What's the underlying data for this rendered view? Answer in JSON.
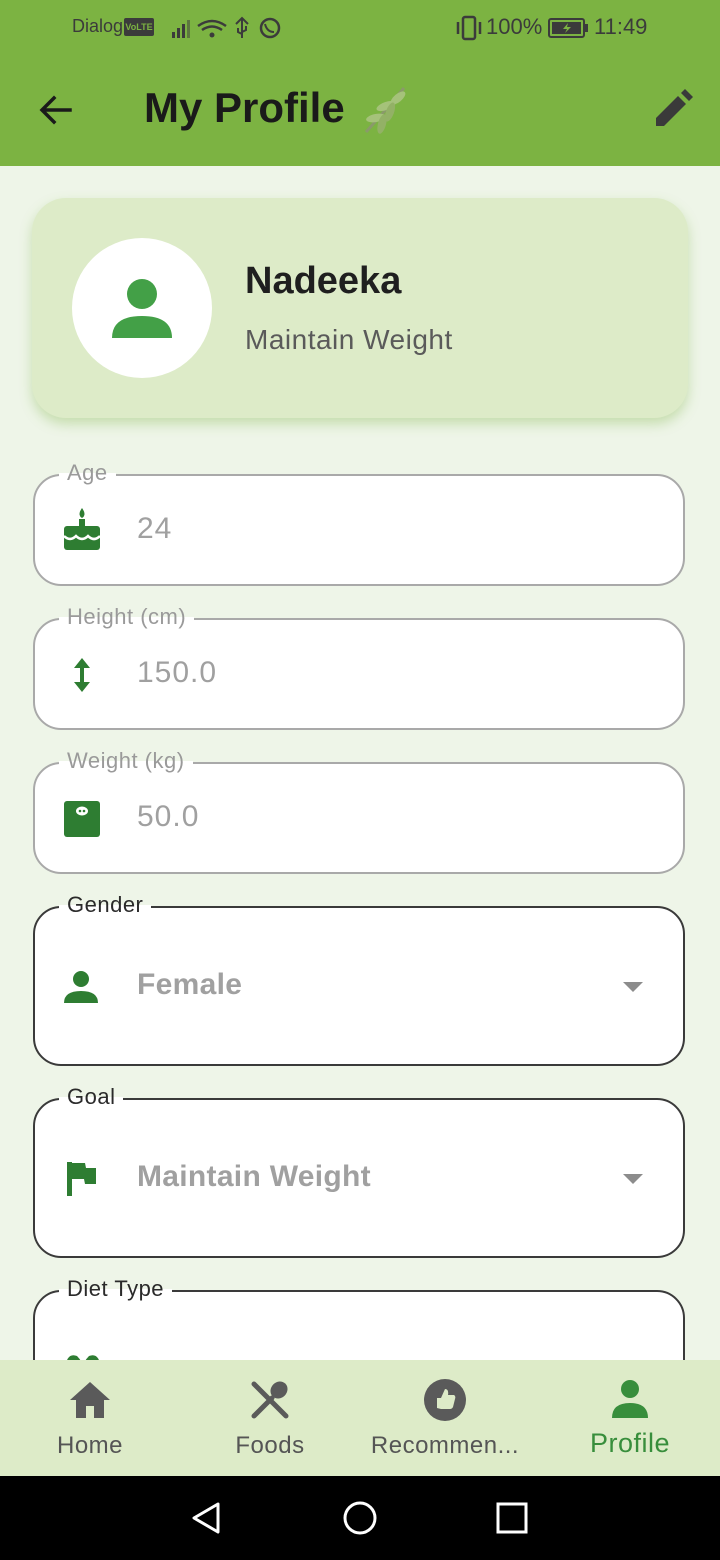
{
  "status_bar": {
    "carrier": "Dialog",
    "volte": "VoLTE",
    "battery": "100%",
    "time": "11:49"
  },
  "app_bar": {
    "title": "My Profile",
    "back_icon": "arrow-left-icon",
    "edit_icon": "pencil-icon",
    "title_icon": "leaf-icon"
  },
  "profile": {
    "name": "Nadeeka",
    "goal": "Maintain Weight"
  },
  "form": {
    "age": {
      "label": "Age",
      "value": "24",
      "icon": "cake-icon"
    },
    "height": {
      "label": "Height (cm)",
      "value": "150.0",
      "icon": "height-icon"
    },
    "weight": {
      "label": "Weight (kg)",
      "value": "50.0",
      "icon": "scale-icon"
    },
    "gender": {
      "label": "Gender",
      "value": "Female",
      "icon": "person-icon"
    },
    "goal": {
      "label": "Goal",
      "value": "Maintain Weight",
      "icon": "flag-icon"
    },
    "diet_type": {
      "label": "Diet Type",
      "icon": "leaf-icon"
    }
  },
  "bottom_nav": [
    {
      "label": "Home",
      "icon": "home-icon"
    },
    {
      "label": "Foods",
      "icon": "fork-spoon-icon"
    },
    {
      "label": "Recommen...",
      "icon": "thumb-up-icon"
    },
    {
      "label": "Profile",
      "icon": "person-icon",
      "active": true
    }
  ],
  "colors": {
    "primary": "#7cb342",
    "accent_green": "#388e3c",
    "card_bg": "#ddebc8",
    "page_bg": "#eef5e8"
  }
}
